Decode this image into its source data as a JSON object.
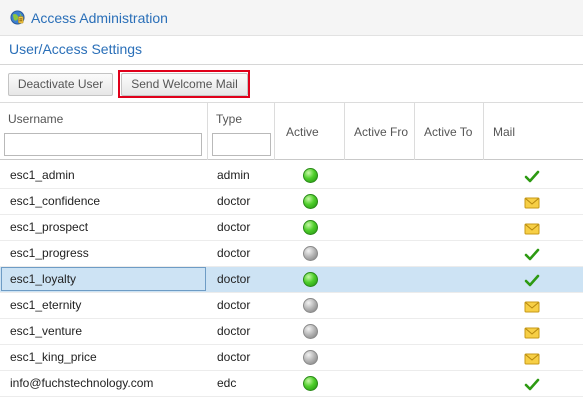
{
  "header": {
    "title": "Access Administration",
    "icon": "globe-icon"
  },
  "section": {
    "title": "User/Access Settings"
  },
  "toolbar": {
    "deactivate_label": "Deactivate User",
    "welcome_label": "Send Welcome Mail"
  },
  "columns": {
    "username": "Username",
    "type": "Type",
    "active": "Active",
    "active_from": "Active Fro",
    "active_to": "Active To",
    "mail": "Mail"
  },
  "filters": {
    "username": "",
    "type": ""
  },
  "status_colors": {
    "active": "#4fcf2b",
    "inactive": "#b3b3b3",
    "selected_row": "#cde3f4",
    "highlight": "#e0001a",
    "accent": "#2a6fb8"
  },
  "rows": [
    {
      "username": "esc1_admin",
      "type": "admin",
      "active": true,
      "active_from": "",
      "active_to": "",
      "mail": "sent"
    },
    {
      "username": "esc1_confidence",
      "type": "doctor",
      "active": true,
      "active_from": "",
      "active_to": "",
      "mail": "pending"
    },
    {
      "username": "esc1_prospect",
      "type": "doctor",
      "active": true,
      "active_from": "",
      "active_to": "",
      "mail": "pending"
    },
    {
      "username": "esc1_progress",
      "type": "doctor",
      "active": false,
      "active_from": "",
      "active_to": "",
      "mail": "sent"
    },
    {
      "username": "esc1_loyalty",
      "type": "doctor",
      "active": true,
      "active_from": "",
      "active_to": "",
      "mail": "sent",
      "selected": true
    },
    {
      "username": "esc1_eternity",
      "type": "doctor",
      "active": false,
      "active_from": "",
      "active_to": "",
      "mail": "pending"
    },
    {
      "username": "esc1_venture",
      "type": "doctor",
      "active": false,
      "active_from": "",
      "active_to": "",
      "mail": "pending"
    },
    {
      "username": "esc1_king_price",
      "type": "doctor",
      "active": false,
      "active_from": "",
      "active_to": "",
      "mail": "pending"
    },
    {
      "username": "info@fuchstechnology.com",
      "type": "edc",
      "active": true,
      "active_from": "",
      "active_to": "",
      "mail": "sent"
    }
  ]
}
